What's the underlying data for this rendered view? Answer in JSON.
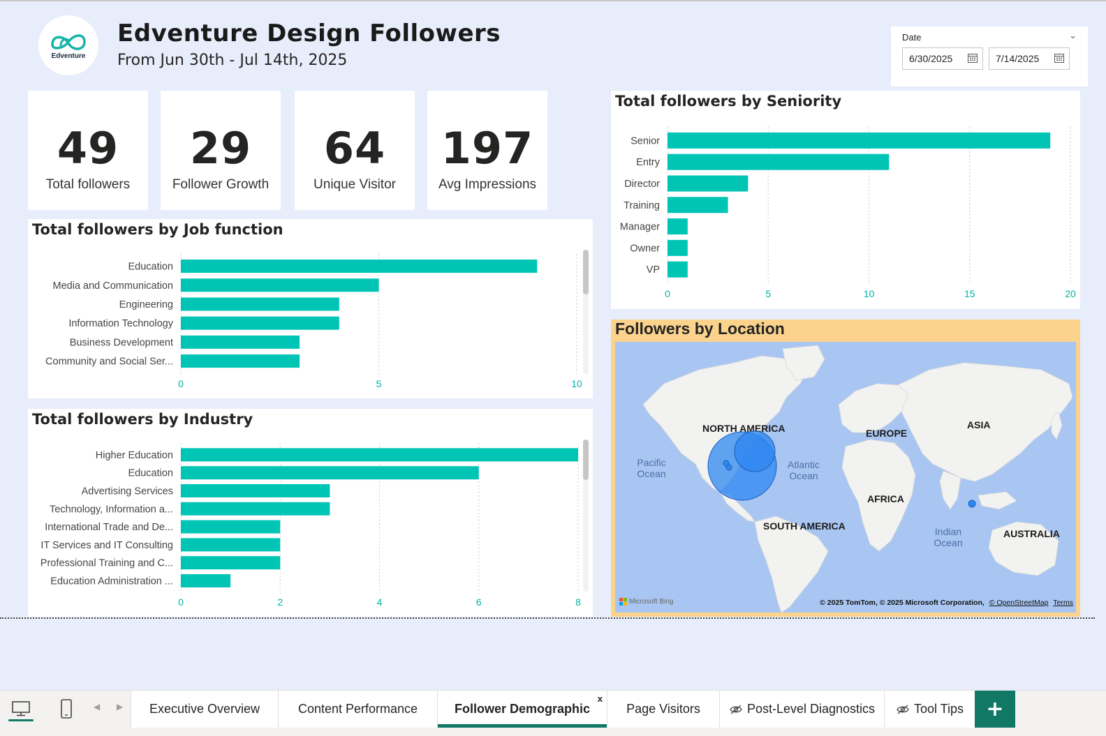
{
  "header": {
    "logo_text": "Edventure",
    "title": "Edventure Design Followers",
    "subtitle": "From Jun 30th - Jul 14th, 2025"
  },
  "slicer": {
    "label": "Date",
    "from": "6/30/2025",
    "to": "7/14/2025"
  },
  "kpis": [
    {
      "value": "49",
      "label": "Total followers"
    },
    {
      "value": "29",
      "label": "Follower Growth"
    },
    {
      "value": "64",
      "label": "Unique Visitor"
    },
    {
      "value": "197",
      "label": "Avg Impressions"
    }
  ],
  "colors": {
    "bar": "#00c5b5",
    "accent": "#117865",
    "background": "#e8edfb",
    "map_frame": "#fbd38d",
    "bubble": "#2e87f0"
  },
  "chart_data": [
    {
      "id": "job",
      "type": "bar",
      "orientation": "horizontal",
      "title": "Total followers by Job function",
      "categories": [
        "Education",
        "Media and Communication",
        "Engineering",
        "Information Technology",
        "Business Development",
        "Community and Social Ser..."
      ],
      "values": [
        9,
        5,
        4,
        4,
        3,
        3
      ],
      "xlim": [
        0,
        10
      ],
      "xticks": [
        0,
        5,
        10
      ],
      "grid": true
    },
    {
      "id": "industry",
      "type": "bar",
      "orientation": "horizontal",
      "title": "Total followers by Industry",
      "categories": [
        "Higher Education",
        "Education",
        "Advertising Services",
        "Technology, Information a...",
        "International Trade and De...",
        "IT Services and IT Consulting",
        "Professional Training and C...",
        "Education Administration ..."
      ],
      "values": [
        8,
        6,
        3,
        3,
        2,
        2,
        2,
        1
      ],
      "xlim": [
        0,
        8
      ],
      "xticks": [
        0,
        2,
        4,
        6,
        8
      ],
      "grid": true
    },
    {
      "id": "seniority",
      "type": "bar",
      "orientation": "horizontal",
      "title": "Total followers by Seniority",
      "categories": [
        "Senior",
        "Entry",
        "Director",
        "Training",
        "Manager",
        "Owner",
        "VP"
      ],
      "values": [
        19,
        11,
        4,
        3,
        1,
        1,
        1
      ],
      "xlim": [
        0,
        20
      ],
      "xticks": [
        0,
        5,
        10,
        15,
        20
      ],
      "grid": true
    }
  ],
  "map": {
    "title": "Followers by Location",
    "continents": [
      "NORTH AMERICA",
      "EUROPE",
      "ASIA",
      "AFRICA",
      "SOUTH AMERICA",
      "AUSTRALIA"
    ],
    "oceans": [
      "Pacific Ocean",
      "Atlantic Ocean",
      "Indian Ocean"
    ],
    "brand": "Microsoft Bing",
    "attribution": "© 2025 TomTom, © 2025 Microsoft Corporation,",
    "osm": "© OpenStreetMap",
    "terms": "Terms"
  },
  "tabs": [
    {
      "label": "Executive Overview",
      "hidden": false
    },
    {
      "label": "Content Performance",
      "hidden": false
    },
    {
      "label": "Follower Demographic",
      "hidden": false,
      "active": true
    },
    {
      "label": "Page Visitors",
      "hidden": false
    },
    {
      "label": "Post-Level Diagnostics",
      "hidden": true
    },
    {
      "label": "Tool Tips",
      "hidden": true
    }
  ],
  "tab_close": "x",
  "add_tab": "+"
}
